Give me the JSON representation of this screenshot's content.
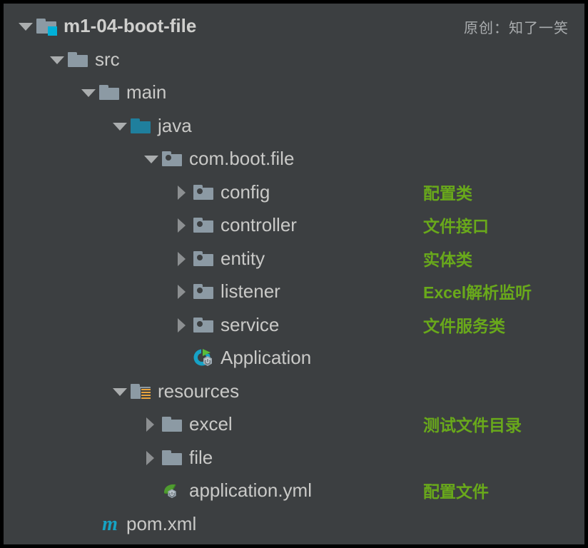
{
  "watermark": "原创：知了一笑",
  "colors": {
    "background": "#3c3f41",
    "frame": "#000000",
    "text": "#c9c9c7",
    "folder": "#8c9aa4",
    "folder_source": "#1f7f9d",
    "module_badge": "#00b0d8",
    "resource_stripes": "#e8a33d",
    "annotation_green": "#69a91b",
    "maven_cyan": "#16a3c4",
    "spring_green": "#4f9c2f"
  },
  "tree": [
    {
      "label": "m1-04-boot-file",
      "icon": "module-folder-icon",
      "arrow": "down",
      "depth": 0,
      "bold": true,
      "note": ""
    },
    {
      "label": "src",
      "icon": "folder-icon",
      "arrow": "down",
      "depth": 1,
      "bold": false,
      "note": ""
    },
    {
      "label": "main",
      "icon": "folder-icon",
      "arrow": "down",
      "depth": 2,
      "bold": false,
      "note": ""
    },
    {
      "label": "java",
      "icon": "source-folder-icon",
      "arrow": "down",
      "depth": 3,
      "bold": false,
      "note": ""
    },
    {
      "label": "com.boot.file",
      "icon": "package-icon",
      "arrow": "down",
      "depth": 4,
      "bold": false,
      "note": ""
    },
    {
      "label": "config",
      "icon": "package-icon",
      "arrow": "right",
      "depth": 5,
      "bold": false,
      "note": "配置类"
    },
    {
      "label": "controller",
      "icon": "package-icon",
      "arrow": "right",
      "depth": 5,
      "bold": false,
      "note": "文件接口"
    },
    {
      "label": "entity",
      "icon": "package-icon",
      "arrow": "right",
      "depth": 5,
      "bold": false,
      "note": "实体类"
    },
    {
      "label": "listener",
      "icon": "package-icon",
      "arrow": "right",
      "depth": 5,
      "bold": false,
      "note": "Excel解析监听"
    },
    {
      "label": "service",
      "icon": "package-icon",
      "arrow": "right",
      "depth": 5,
      "bold": false,
      "note": "文件服务类"
    },
    {
      "label": "Application",
      "icon": "spring-boot-run-icon",
      "arrow": "none",
      "depth": 5,
      "bold": false,
      "note": ""
    },
    {
      "label": "resources",
      "icon": "resources-folder-icon",
      "arrow": "down",
      "depth": 3,
      "bold": false,
      "note": ""
    },
    {
      "label": "excel",
      "icon": "folder-icon",
      "arrow": "right",
      "depth": 4,
      "bold": false,
      "note": "测试文件目录"
    },
    {
      "label": "file",
      "icon": "folder-icon",
      "arrow": "right",
      "depth": 4,
      "bold": false,
      "note": ""
    },
    {
      "label": "application.yml",
      "icon": "spring-config-file-icon",
      "arrow": "none",
      "depth": 4,
      "bold": false,
      "note": "配置文件"
    },
    {
      "label": "pom.xml",
      "icon": "maven-icon",
      "arrow": "none",
      "depth": 2,
      "bold": false,
      "note": ""
    }
  ]
}
